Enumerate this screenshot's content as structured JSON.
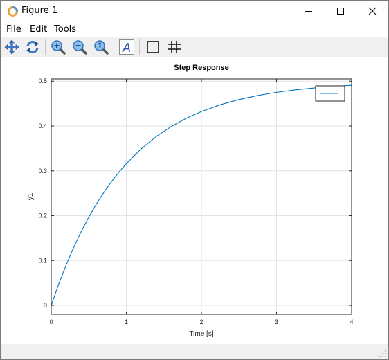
{
  "window": {
    "title": "Figure 1"
  },
  "menu": {
    "file_pre": "",
    "file_ul": "F",
    "file_post": "ile",
    "edit_pre": "",
    "edit_ul": "E",
    "edit_post": "dit",
    "tools_pre": "",
    "tools_ul": "T",
    "tools_post": "ools"
  },
  "toolbar": {
    "icons": [
      "pan-icon",
      "rotate-icon",
      "zoom-in-icon",
      "zoom-out-icon",
      "zoom-reset-icon",
      "text-icon",
      "axes-box-icon",
      "grid-icon"
    ],
    "text_glyph": "A"
  },
  "chart_data": {
    "type": "line",
    "title": "Step Response",
    "xlabel": "Time [s]",
    "ylabel": "y1",
    "xlim": [
      0,
      4
    ],
    "ylim": [
      -0.02,
      0.505
    ],
    "xticks": [
      0,
      1,
      2,
      3,
      4
    ],
    "xtick_labels": [
      "0",
      "1",
      "2",
      "3",
      "4"
    ],
    "yticks": [
      0,
      0.1,
      0.2,
      0.3,
      0.4,
      0.5
    ],
    "ytick_labels": [
      "0",
      "0.1",
      "0.2",
      "0.3",
      "0.4",
      "0.5"
    ],
    "grid": true,
    "legend_placement": "top-right",
    "series": [
      {
        "color": "#0072bd",
        "x": [
          0,
          0.1,
          0.2,
          0.3,
          0.4,
          0.5,
          0.6,
          0.7,
          0.8,
          0.9,
          1.0,
          1.2,
          1.4,
          1.6,
          1.8,
          2.0,
          2.25,
          2.5,
          2.75,
          3.0,
          3.25,
          3.5,
          3.75,
          4.0
        ],
        "y": [
          0,
          0.0476,
          0.0906,
          0.1296,
          0.1648,
          0.1967,
          0.2256,
          0.2517,
          0.2753,
          0.2967,
          0.3161,
          0.3494,
          0.3767,
          0.3991,
          0.4174,
          0.4323,
          0.4474,
          0.459,
          0.468,
          0.4751,
          0.4806,
          0.4849,
          0.4882,
          0.4908
        ]
      }
    ]
  }
}
